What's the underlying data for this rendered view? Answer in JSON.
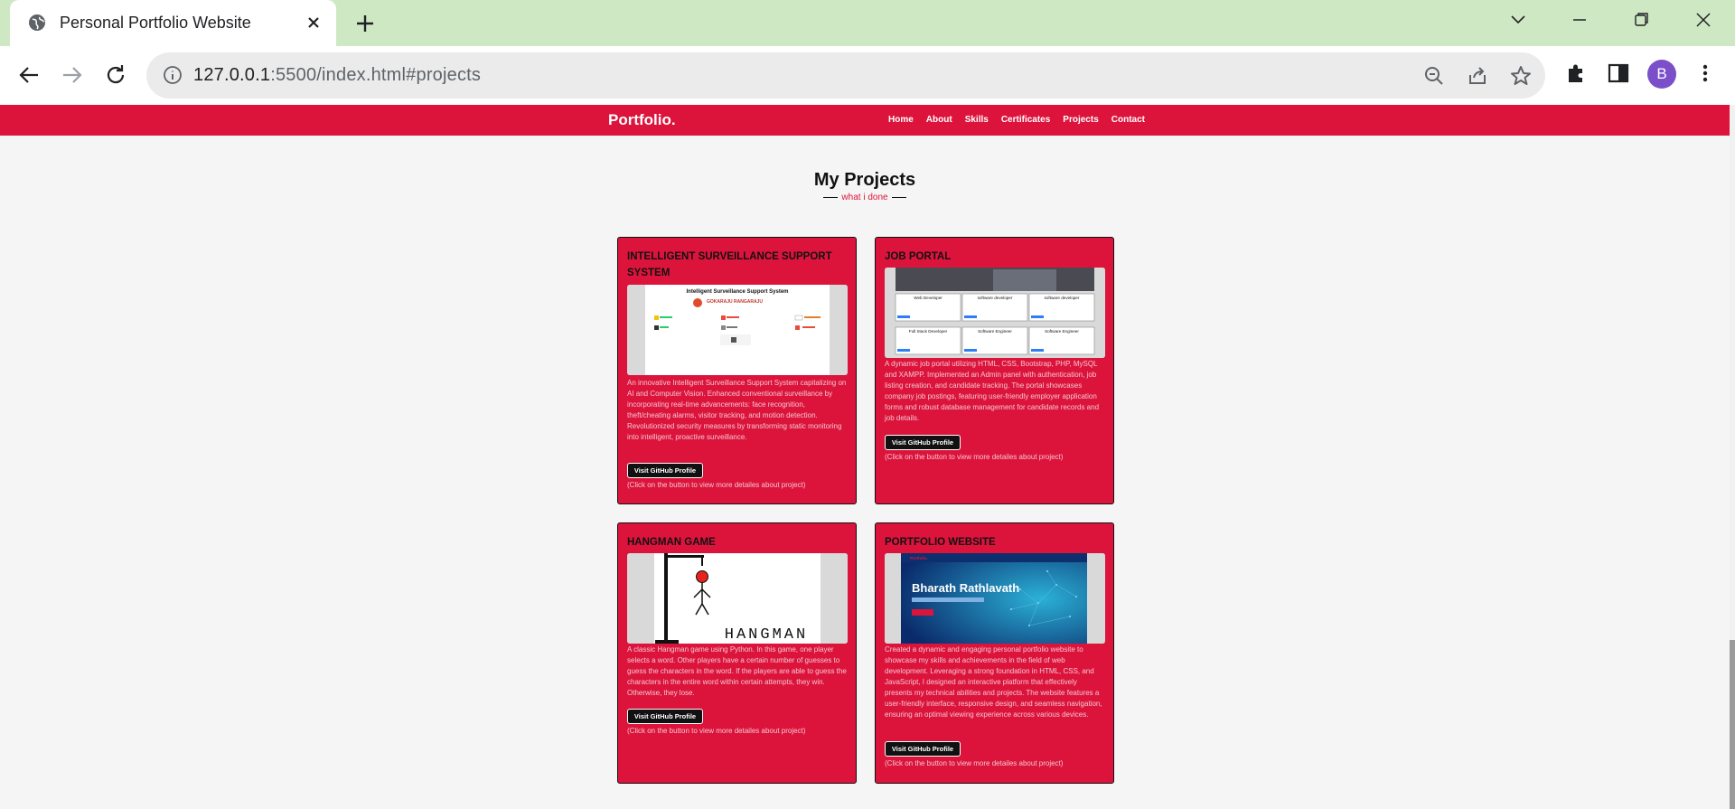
{
  "browser": {
    "tab_title": "Personal Portfolio Website",
    "url_host": "127.0.0.1",
    "url_rest": ":5500/index.html#projects",
    "profile_initial": "B"
  },
  "site": {
    "logo": "Portfolio.",
    "menu": [
      "Home",
      "About",
      "Skills",
      "Certificates",
      "Projects",
      "Contact"
    ],
    "section_title": "My Projects",
    "section_subtitle": "what i done"
  },
  "projects": [
    {
      "title": "INTELLIGENT SURVEILLANCE SUPPORT SYSTEM",
      "image_heading": "Intelligent Surveillance Support System",
      "image_sub": "GOKARAJU RANGARAJU",
      "description": "An innovative Intelligent Surveillance Support System capitalizing on AI and Computer Vision. Enhanced conventional surveillance by incorporating real-time advancements: face recognition, theft/cheating alarms, visitor tracking, and motion detection. Revolutionized security measures by transforming static monitoring into intelligent, proactive surveillance.",
      "button": "Visit GitHub Profile",
      "hint": "(Click on the button to view more detailes about project)"
    },
    {
      "title": "JOB PORTAL",
      "image_jobs": [
        "Web Developer",
        "software developer",
        "software developer",
        "Full Stack Developer",
        "Software Engineer",
        "Software Engineer"
      ],
      "description": "A dynamic job portal utilizing HTML, CSS, Bootstrap, PHP, MySQL and XAMPP. Implemented an Admin panel with authentication, job listing creation, and candidate tracking. The portal showcases company job postings, featuring user-friendly employer application forms and robust database management for candidate records and job details.",
      "button": "Visit GitHub Profile",
      "hint": "(Click on the button to view more detailes about project)"
    },
    {
      "title": "HANGMAN GAME",
      "image_text": "HANGMAN",
      "description": "A classic Hangman game using Python. In this game, one player selects a word. Other players have a certain number of guesses to guess the characters in the word. If the players are able to guess the characters in the entire word within certain attempts, they win. Otherwise, they lose.",
      "button": "Visit GitHub Profile",
      "hint": "(Click on the button to view more detailes about project)"
    },
    {
      "title": "PORTFOLIO WEBSITE",
      "image_name": "Bharath Rathlavath",
      "description": "Created a dynamic and engaging personal portfolio website to showcase my skills and achievements in the field of web development. Leveraging a strong foundation in HTML, CSS, and JavaScript, I designed an interactive platform that effectively presents my technical abilities and projects. The website features a user-friendly interface, responsive design, and seamless navigation, ensuring an optimal viewing experience across various devices.",
      "button": "Visit GitHub Profile",
      "hint": "(Click on the button to view more detailes about project)"
    }
  ],
  "colors": {
    "accent": "#dc143c",
    "tabstrip": "#cfe8c4",
    "page_bg": "#f5f5f5"
  }
}
